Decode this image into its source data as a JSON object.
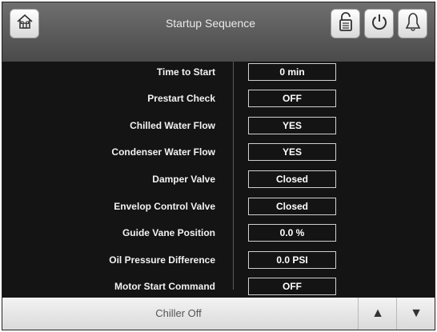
{
  "header": {
    "title": "Startup Sequence",
    "icons": [
      "home-icon",
      "lock-icon",
      "power-icon",
      "bell-icon"
    ]
  },
  "rows": [
    {
      "label": "Time to Start",
      "value": "0 min"
    },
    {
      "label": "Prestart Check",
      "value": "OFF"
    },
    {
      "label": "Chilled Water Flow",
      "value": "YES"
    },
    {
      "label": "Condenser Water Flow",
      "value": "YES"
    },
    {
      "label": "Damper Valve",
      "value": "Closed"
    },
    {
      "label": "Envelop Control Valve",
      "value": "Closed"
    },
    {
      "label": "Guide Vane Position",
      "value": "0.0 %"
    },
    {
      "label": "Oil Pressure Difference",
      "value": "0.0 PSI"
    },
    {
      "label": "Motor Start Command",
      "value": "OFF"
    }
  ],
  "footer": {
    "status": "Chiller Off",
    "up_glyph": "▲",
    "down_glyph": "▼"
  }
}
